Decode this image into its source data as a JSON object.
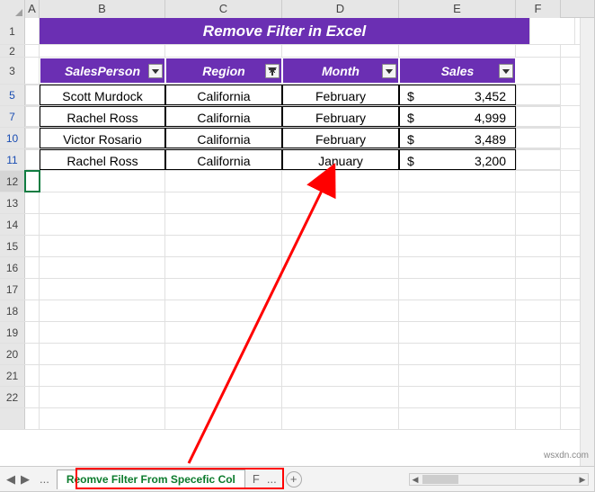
{
  "columns": [
    "A",
    "B",
    "C",
    "D",
    "E",
    "F"
  ],
  "title": "Remove Filter in Excel",
  "headers": {
    "b": "SalesPerson",
    "c": "Region",
    "d": "Month",
    "e": "Sales"
  },
  "filters": {
    "b": "unfiltered",
    "c": "filtered",
    "d": "unfiltered",
    "e": "unfiltered"
  },
  "visible_row_numbers": [
    "1",
    "2",
    "3",
    "5",
    "7",
    "10",
    "11",
    "12",
    "13",
    "14",
    "15",
    "16",
    "17",
    "18",
    "19",
    "20",
    "21",
    "22"
  ],
  "data_rows": [
    {
      "row": "5",
      "person": "Scott Murdock",
      "region": "California",
      "month": "February",
      "sales": "3,452"
    },
    {
      "row": "7",
      "person": "Rachel Ross",
      "region": "California",
      "month": "February",
      "sales": "4,999"
    },
    {
      "row": "10",
      "person": "Victor Rosario",
      "region": "California",
      "month": "February",
      "sales": "3,489"
    },
    {
      "row": "11",
      "person": "Rachel Ross",
      "region": "California",
      "month": "January",
      "sales": "3,200"
    }
  ],
  "currency": "$",
  "tabs": {
    "dots": "...",
    "active_label": "Reomve Filter From Specefic Col",
    "next_label_hint": "F",
    "ellipsis": "...",
    "add": "+"
  },
  "nav": {
    "prev": "◀",
    "next": "▶"
  },
  "watermark": "wsxdn.com",
  "selected_cell": "A12"
}
